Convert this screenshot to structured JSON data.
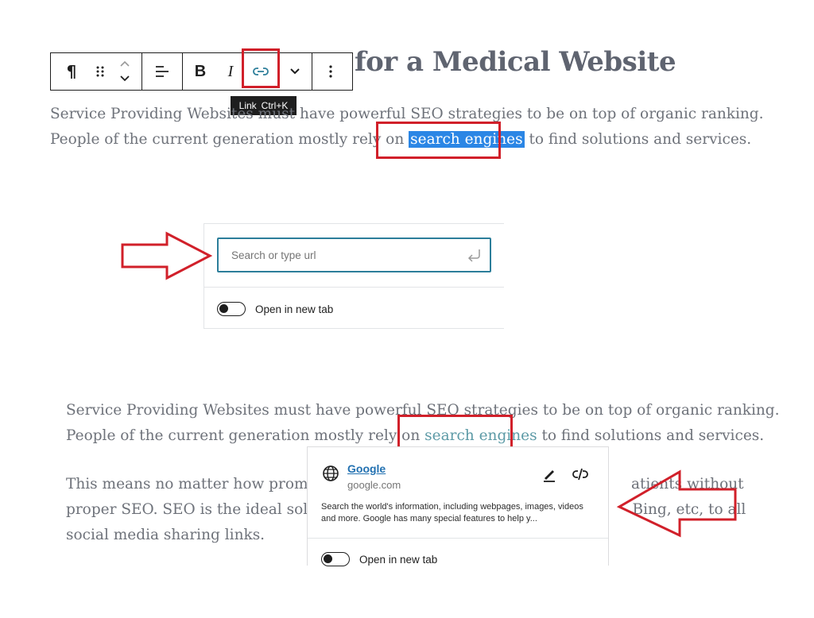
{
  "heading": {
    "text_visible": "for a Medical Website"
  },
  "toolbar": {
    "paragraph_icon": "¶",
    "bold_label": "B",
    "italic_label": "I"
  },
  "tooltip": {
    "label": "Link",
    "shortcut": "Ctrl+K"
  },
  "paragraph1": {
    "line1": "Service Providing Websites must have powerful SEO strategies to be on top of organic ranking.",
    "line2_before": "People of the current generation mostly rely on ",
    "line2_selected": "search engines",
    "line2_after": " to find solutions and services."
  },
  "link_popover": {
    "placeholder": "Search or type url",
    "toggle_label": "Open in new tab"
  },
  "paragraph2": {
    "line1": "Service Providing Websites must have powerful SEO strategies to be on top of organic ranking.",
    "line2_before": "People of the current generation mostly rely on ",
    "line2_link": "search engines",
    "line2_after": " to find solutions and services."
  },
  "paragraph3": {
    "line1_left": "This means no matter how promis",
    "line1_right": "atients without",
    "line2_left": "proper SEO.  SEO is the ideal solut",
    "line2_right": "Bing, etc, to all",
    "line3": "social media sharing links."
  },
  "link_preview": {
    "title": "Google",
    "url": "google.com",
    "description": "Search the world's information, including webpages, images, videos and more. Google has many special features to help y...",
    "toggle_label": "Open in new tab"
  },
  "colors": {
    "annotation_red": "#d1202a",
    "selection_blue": "#2b86e5",
    "focus_teal": "#2c7e9a"
  }
}
